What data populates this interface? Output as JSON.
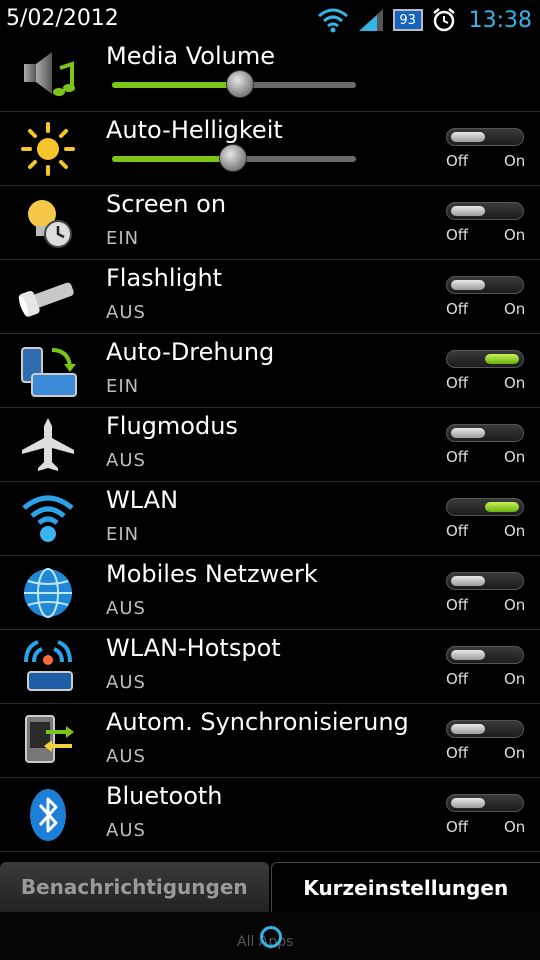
{
  "status": {
    "date": "5/02/2012",
    "battery": "93",
    "time": "13:38"
  },
  "toggle_labels": {
    "off": "Off",
    "on": "On"
  },
  "sliders": [
    {
      "title": "Media Volume",
      "value": 0.52
    },
    {
      "title": "Auto-Helligkeit",
      "value": 0.49
    }
  ],
  "settings": [
    {
      "title": "Screen on",
      "status": "EIN",
      "on": false,
      "icon": "bulb-clock-icon"
    },
    {
      "title": "Flashlight",
      "status": "AUS",
      "on": false,
      "icon": "flashlight-icon"
    },
    {
      "title": "Auto-Drehung",
      "status": "EIN",
      "on": true,
      "icon": "rotate-icon"
    },
    {
      "title": "Flugmodus",
      "status": "AUS",
      "on": false,
      "icon": "airplane-icon"
    },
    {
      "title": "WLAN",
      "status": "EIN",
      "on": true,
      "icon": "wifi-icon"
    },
    {
      "title": "Mobiles Netzwerk",
      "status": "AUS",
      "on": false,
      "icon": "globe-icon"
    },
    {
      "title": "WLAN-Hotspot",
      "status": "AUS",
      "on": false,
      "icon": "hotspot-icon"
    },
    {
      "title": "Autom. Synchronisierung",
      "status": "AUS",
      "on": false,
      "icon": "sync-icon"
    },
    {
      "title": "Bluetooth",
      "status": "AUS",
      "on": false,
      "icon": "bluetooth-icon"
    }
  ],
  "auto_brightness_toggle_on": false,
  "tabs": {
    "notifications": "Benachrichtigungen",
    "quick_settings": "Kurzeinstellungen"
  },
  "dock": {
    "all_apps": "All Apps"
  },
  "colors": {
    "accent": "#33b5e5",
    "toggle_on": "#7cc516"
  }
}
